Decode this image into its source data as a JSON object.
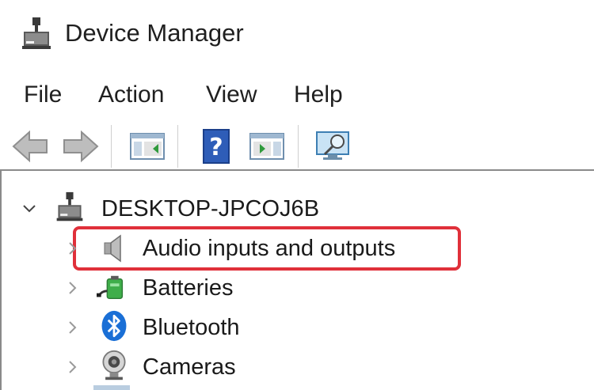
{
  "window": {
    "title": "Device Manager",
    "icon": "device-manager-icon"
  },
  "menu": {
    "items": [
      {
        "label": "File"
      },
      {
        "label": "Action"
      },
      {
        "label": "View"
      },
      {
        "label": "Help"
      }
    ]
  },
  "toolbar": {
    "buttons": [
      {
        "icon": "back-arrow-icon"
      },
      {
        "icon": "forward-arrow-icon"
      },
      {
        "icon": "show-hide-console-tree-icon"
      },
      {
        "icon": "help-icon"
      },
      {
        "icon": "properties-pane-icon"
      },
      {
        "icon": "scan-hardware-monitor-icon"
      }
    ]
  },
  "tree": {
    "root": {
      "label": "DESKTOP-JPCOJ6B",
      "expanded": true,
      "icon": "computer-icon"
    },
    "items": [
      {
        "label": "Audio inputs and outputs",
        "icon": "speaker-icon",
        "highlighted": true
      },
      {
        "label": "Batteries",
        "icon": "battery-icon",
        "highlighted": false
      },
      {
        "label": "Bluetooth",
        "icon": "bluetooth-icon",
        "highlighted": false
      },
      {
        "label": "Cameras",
        "icon": "webcam-icon",
        "highlighted": false
      }
    ]
  },
  "colors": {
    "highlight_border": "#e0303a",
    "bluetooth_blue": "#1a6fd6",
    "panel_border": "#8a8a8a"
  }
}
